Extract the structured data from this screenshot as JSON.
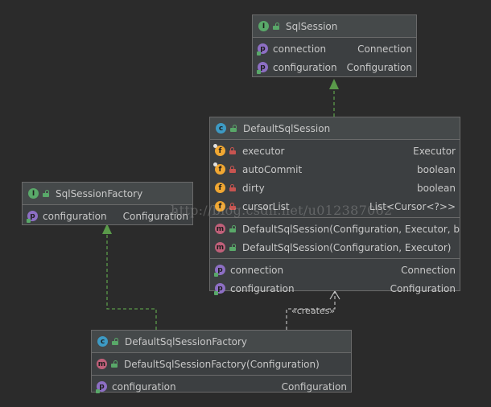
{
  "sql_session": {
    "title": "SqlSession",
    "icon": "interface-icon",
    "props": [
      {
        "name": "connection",
        "type": "Connection"
      },
      {
        "name": "configuration",
        "type": "Configuration"
      }
    ]
  },
  "default_sql_session": {
    "title": "DefaultSqlSession",
    "icon": "class-icon",
    "fields": [
      {
        "name": "executor",
        "type": "Executor"
      },
      {
        "name": "autoCommit",
        "type": "boolean"
      },
      {
        "name": "dirty",
        "type": "boolean"
      },
      {
        "name": "cursorList",
        "type": "List<Cursor<?>>"
      }
    ],
    "methods": [
      {
        "name": "DefaultSqlSession(Configuration, Executor, boo"
      },
      {
        "name": "DefaultSqlSession(Configuration, Executor)"
      }
    ],
    "props": [
      {
        "name": "connection",
        "type": "Connection"
      },
      {
        "name": "configuration",
        "type": "Configuration"
      }
    ]
  },
  "sql_session_factory": {
    "title": "SqlSessionFactory",
    "icon": "interface-icon",
    "props": [
      {
        "name": "configuration",
        "type": "Configuration"
      }
    ]
  },
  "default_sql_session_factory": {
    "title": "DefaultSqlSessionFactory",
    "icon": "class-icon",
    "methods": [
      {
        "name": "DefaultSqlSessionFactory(Configuration)"
      }
    ],
    "props": [
      {
        "name": "configuration",
        "type": "Configuration"
      }
    ]
  },
  "relations": {
    "creates_label": "«creates»"
  },
  "watermark": "http://blog.csdn.net/u012387062",
  "colors": {
    "background": "#2b2b2b",
    "box": "#3c3f41",
    "border": "#6a6a6a",
    "arrow": "#5a9a4a",
    "dependency": "#c8c8c8"
  }
}
